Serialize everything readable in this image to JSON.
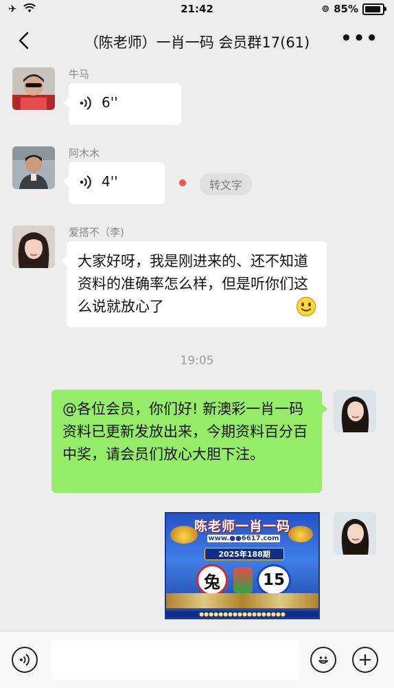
{
  "status": {
    "time": "21:42",
    "battery": "85%"
  },
  "header": {
    "title": "（陈老师）一肖一码 会员群17(61)",
    "more": "•••"
  },
  "messages": [
    {
      "sender": "牛马",
      "duration": "6''"
    },
    {
      "sender": "阿木木",
      "duration": "4''",
      "to_text": "转文字"
    },
    {
      "sender": "爱搭不（李)",
      "text": "大家好呀，我是刚进来的、还不知道资料的准确率怎么样，但是听你们这么说就放心了"
    }
  ],
  "time_separator": "19:05",
  "outgoing": {
    "text": "@各位会员，你们好! 新澳彩一肖一码资料已更新发放出来，今期资料百分百中奖，请会员们放心大胆下注。",
    "image": {
      "title": "陈老师一肖一码",
      "url_line": "www.●●6617.com",
      "period": "2025年188期",
      "animal": "兔",
      "number": "15",
      "footer": "●●●●●●●●●●●●●●●●●●"
    }
  },
  "colors": {
    "green_bubble": "#95ec69",
    "background": "#ededed"
  }
}
